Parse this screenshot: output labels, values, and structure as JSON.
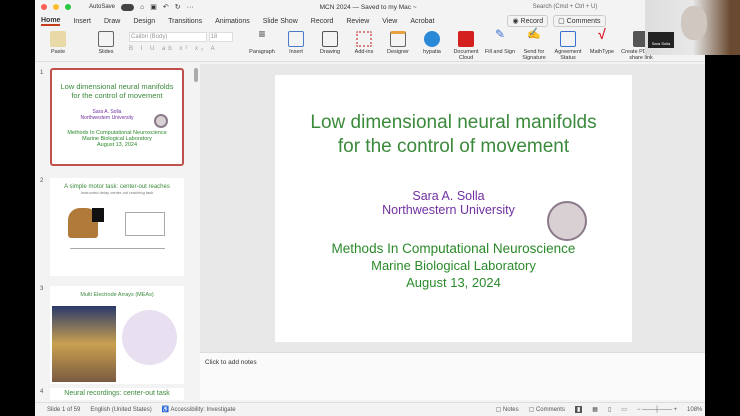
{
  "titlebar": {
    "autosave": "AutoSave",
    "doc_title": "MCN  2024 — Saved to my Mac ~",
    "search_placeholder": "Search (Cmd + Ctrl + U)"
  },
  "tabs": [
    "Home",
    "Insert",
    "Draw",
    "Design",
    "Transitions",
    "Animations",
    "Slide Show",
    "Record",
    "Review",
    "View",
    "Acrobat"
  ],
  "record_button": "Record",
  "comments_button": "Comments",
  "ribbon": {
    "paste": "Paste",
    "slides": "Slides",
    "font": "Calibri (Body)",
    "size": "18",
    "groups": [
      "Paragraph",
      "Insert",
      "Drawing",
      "Add-ins",
      "Designer",
      "hypatia",
      "Document Cloud",
      "Fill and Sign",
      "Send for Signature",
      "Agreement Status",
      "MathType",
      "Create PDF and share link"
    ]
  },
  "webcam": {
    "name_label": "Sara Solla"
  },
  "thumbnails": [
    {
      "num": "1",
      "title": "Low dimensional neural manifolds for the control of movement",
      "author": "Sara A. Solla",
      "affil": "Northwestern University",
      "l1": "Methods In Computational Neuroscience",
      "l2": "Marine Biological Laboratory",
      "l3": "August 13, 2024"
    },
    {
      "num": "2",
      "title": "A simple motor task: center-out reaches",
      "subtitle": "Instructed delay center-out reaching task"
    },
    {
      "num": "3",
      "title": "Multi Electrode Arrays (MEAs)"
    },
    {
      "num": "4",
      "title": "Neural recordings: center-out task"
    }
  ],
  "slide": {
    "title1": "Low dimensional neural manifolds",
    "title2": "for the control of movement",
    "author": "Sara A. Solla",
    "affil": "Northwestern University",
    "l1": "Methods In Computational Neuroscience",
    "l2": "Marine Biological Laboratory",
    "l3": "August 13, 2024"
  },
  "notes_placeholder": "Click to add notes",
  "status": {
    "slide": "Slide 1 of 59",
    "language": "English (United States)",
    "accessibility": "Accessibility: Investigate",
    "notes": "Notes",
    "comments": "Comments",
    "zoom": "108%"
  }
}
